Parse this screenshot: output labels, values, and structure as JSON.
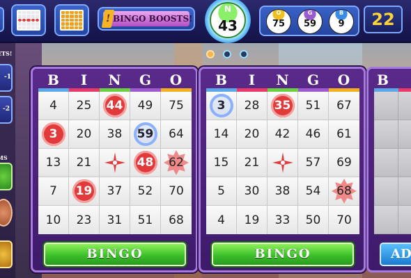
{
  "topbar": {
    "boost_label": "BINGO BOOSTS!",
    "boost_mark": "!",
    "current_ball": {
      "letter": "N",
      "number": "43",
      "color": "#5ad048"
    },
    "previous_balls": [
      {
        "letter": "O",
        "number": "75",
        "color": "#f0c020"
      },
      {
        "letter": "G",
        "number": "59",
        "color": "#9a5ad0"
      },
      {
        "letter": "B",
        "number": "9",
        "color": "#3a8ae8"
      }
    ],
    "balls_remaining": "22"
  },
  "sidebar": {
    "label_top": "ETS!",
    "label_top_2": "-1",
    "label_mid": "-2",
    "label_lower": "MS"
  },
  "cards": [
    {
      "header": [
        "B",
        "I",
        "N",
        "G",
        "O"
      ],
      "cells": [
        [
          {
            "n": "4"
          },
          {
            "n": "25"
          },
          {
            "n": "44",
            "s": "daub"
          },
          {
            "n": "49"
          },
          {
            "n": "75"
          }
        ],
        [
          {
            "n": "3",
            "s": "daub"
          },
          {
            "n": "20"
          },
          {
            "n": "38"
          },
          {
            "n": "59",
            "s": "ring"
          },
          {
            "n": "64"
          }
        ],
        [
          {
            "n": "13"
          },
          {
            "n": "21"
          },
          {
            "n": "",
            "s": "star"
          },
          {
            "n": "48",
            "s": "daub"
          },
          {
            "n": "62",
            "s": "burst"
          }
        ],
        [
          {
            "n": "7"
          },
          {
            "n": "19",
            "s": "daub"
          },
          {
            "n": "37"
          },
          {
            "n": "52"
          },
          {
            "n": "70"
          }
        ],
        [
          {
            "n": "10"
          },
          {
            "n": "23"
          },
          {
            "n": "31"
          },
          {
            "n": "51"
          },
          {
            "n": "68"
          }
        ]
      ],
      "button_label": "BINGO"
    },
    {
      "header": [
        "B",
        "I",
        "N",
        "G",
        "O"
      ],
      "cells": [
        [
          {
            "n": "3",
            "s": "ring"
          },
          {
            "n": "28"
          },
          {
            "n": "35",
            "s": "daub"
          },
          {
            "n": "51"
          },
          {
            "n": "67"
          }
        ],
        [
          {
            "n": "14"
          },
          {
            "n": "20"
          },
          {
            "n": "42"
          },
          {
            "n": "46"
          },
          {
            "n": "61"
          }
        ],
        [
          {
            "n": "15"
          },
          {
            "n": "21"
          },
          {
            "n": "",
            "s": "star"
          },
          {
            "n": "57"
          },
          {
            "n": "69"
          }
        ],
        [
          {
            "n": "5"
          },
          {
            "n": "30"
          },
          {
            "n": "38"
          },
          {
            "n": "54"
          },
          {
            "n": "68",
            "s": "burst"
          }
        ],
        [
          {
            "n": "4"
          },
          {
            "n": "19"
          },
          {
            "n": "33"
          },
          {
            "n": "50"
          },
          {
            "n": "70"
          }
        ]
      ],
      "button_label": "BINGO"
    }
  ],
  "card3": {
    "header": "B",
    "button_label": "AD"
  },
  "colors": {
    "col_b": "#5aa8e8",
    "col_i": "#e83a6a",
    "col_n": "#6ad040",
    "col_g": "#a05ad0",
    "col_o": "#f0b020",
    "daub": "#e23a3a",
    "bingo_button": "#3cc02a"
  },
  "page_indicator": {
    "pages": 3,
    "active": 0
  }
}
